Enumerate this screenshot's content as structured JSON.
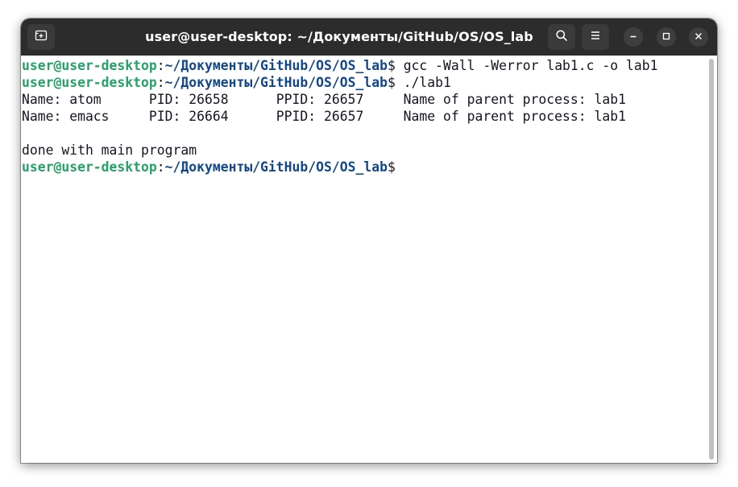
{
  "window": {
    "title": "user@user-desktop: ~/Документы/GitHub/OS/OS_lab"
  },
  "icons": {
    "new_tab": "new-tab-icon",
    "search": "search-icon",
    "menu": "hamburger-menu-icon",
    "minimize": "minimize-icon",
    "maximize": "maximize-icon",
    "close": "close-icon"
  },
  "colors": {
    "prompt_user": "#26a269",
    "prompt_path": "#12488b",
    "titlebar": "#2c2c2c",
    "text": "#171421"
  },
  "terminal": {
    "line1": {
      "user": "user@user-desktop",
      "colon": ":",
      "path": "~/Документы/GitHub/OS/OS_lab",
      "dollar": "$",
      "command": " gcc -Wall -Werror lab1.c -o lab1"
    },
    "line2": {
      "user": "user@user-desktop",
      "colon": ":",
      "path": "~/Документы/GitHub/OS/OS_lab",
      "dollar": "$",
      "command": " ./lab1"
    },
    "line3": "Name: atom      PID: 26658      PPID: 26657     Name of parent process: lab1",
    "line4": "Name: emacs     PID: 26664      PPID: 26657     Name of parent process: lab1",
    "line5": "",
    "line6": "done with main program",
    "line7": {
      "user": "user@user-desktop",
      "colon": ":",
      "path": "~/Документы/GitHub/OS/OS_lab",
      "dollar": "$",
      "command": ""
    }
  }
}
